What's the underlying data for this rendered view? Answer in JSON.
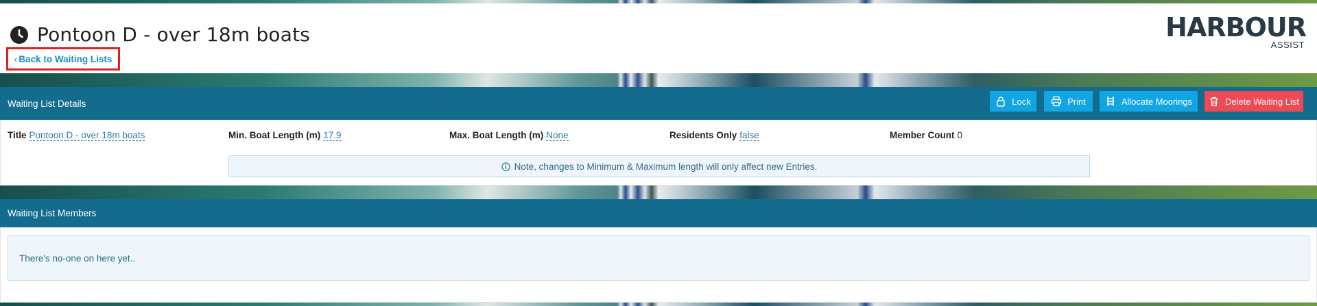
{
  "header": {
    "title": "Pontoon D - over 18m boats",
    "back_link": "Back to Waiting Lists",
    "logo_text": "HARBOUR",
    "logo_sub": "ASSIST"
  },
  "details_panel": {
    "heading": "Waiting List Details",
    "buttons": {
      "lock": "Lock",
      "print": "Print",
      "allocate": "Allocate Moorings",
      "delete": "Delete Waiting List"
    },
    "fields": {
      "title_label": "Title",
      "title_value": "Pontoon D - over 18m boats",
      "min_label": "Min. Boat Length (m)",
      "min_value": "17.9",
      "max_label": "Max. Boat Length (m)",
      "max_value": "None",
      "residents_label": "Residents Only",
      "residents_value": "false",
      "count_label": "Member Count",
      "count_value": "0"
    },
    "note": "Note, changes to Minimum & Maximum length will only affect new Entries."
  },
  "members_panel": {
    "heading": "Waiting List Members",
    "empty_message": "There's no-one on here yet.."
  },
  "colors": {
    "panel_header": "#136c8d",
    "primary_button": "#12a5e3",
    "danger_button": "#ee4a55",
    "link": "#1b8bc3",
    "highlight_border": "#e0201f"
  }
}
